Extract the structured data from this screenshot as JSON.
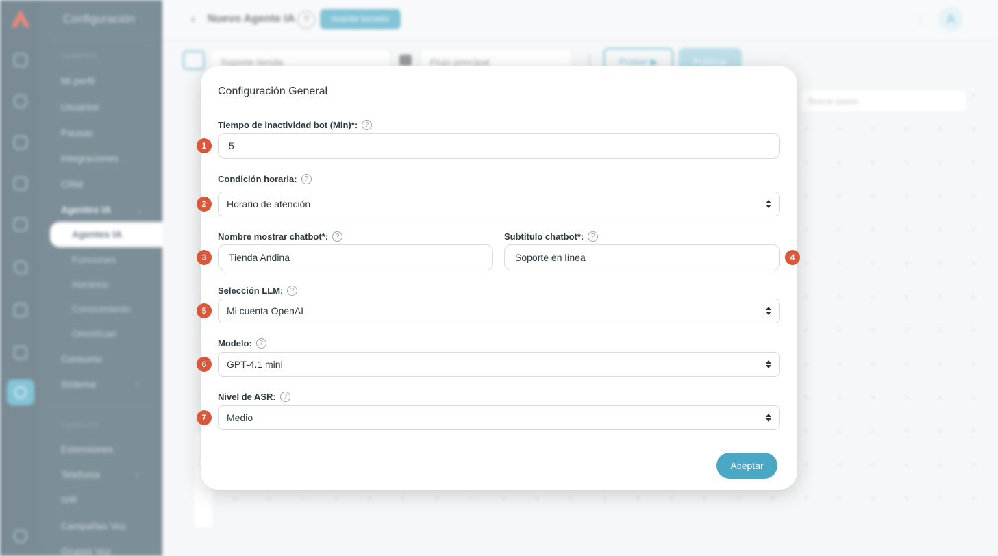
{
  "sidebar": {
    "title": "Configuración",
    "section_general": "GENERAL",
    "section_channels": "CANALES",
    "items": {
      "mi_perfil": "Mi perfil",
      "usuarios": "Usuarios",
      "pausas": "Pausas",
      "integraciones": "Integraciones",
      "crm": "CRM",
      "agentes_ia": "Agentes IA",
      "agentes_ia_sub": "Agentes IA",
      "funciones": "Funciones",
      "horarios": "Horarios",
      "conocimiento": "Conocimiento",
      "omniscan": "OmniScan",
      "consumo": "Consumo",
      "sistema": "Sistema",
      "extensiones": "Extensiones",
      "telefonia": "Telefonía",
      "ivr": "IVR",
      "campanas_voz": "Campañas Voz",
      "grupos_voz": "Grupos Voz"
    }
  },
  "header": {
    "back": "‹",
    "title": "Nuevo Agente IA",
    "help": "?",
    "draft_button": "Guardar borrador",
    "avatar_initial": "A"
  },
  "toolbar": {
    "bot_name": "Soporte tienda",
    "flow_select": "Flujo principal",
    "test_button": "Probar ▶",
    "publish_button": "Publicar",
    "search_steps_placeholder": "Buscar pasos"
  },
  "modal": {
    "title": "Configuración General",
    "fields": {
      "inactivity": {
        "label": "Tiempo de inactividad bot (Min)*:",
        "value": "5",
        "badge": "1"
      },
      "schedule": {
        "label": "Condición horaria:",
        "value": "Horario de atención",
        "badge": "2"
      },
      "display_name": {
        "label": "Nombre mostrar chatbot*:",
        "value": "Tienda Andina",
        "badge": "3"
      },
      "subtitle": {
        "label": "Subtítulo chatbot*:",
        "value": "Soporte en línea",
        "badge": "4"
      },
      "llm": {
        "label": "Selección LLM:",
        "value": "Mi cuenta OpenAI",
        "badge": "5"
      },
      "model": {
        "label": "Modelo:",
        "value": "GPT-4.1 mini",
        "badge": "6"
      },
      "asr": {
        "label": "Nivel de ASR:",
        "value": "Medio",
        "badge": "7"
      }
    },
    "help_glyph": "?",
    "accept_button": "Aceptar"
  },
  "colors": {
    "accent": "#4aa8c4",
    "badge": "#d9573a",
    "sidebar": "#3f5968"
  }
}
